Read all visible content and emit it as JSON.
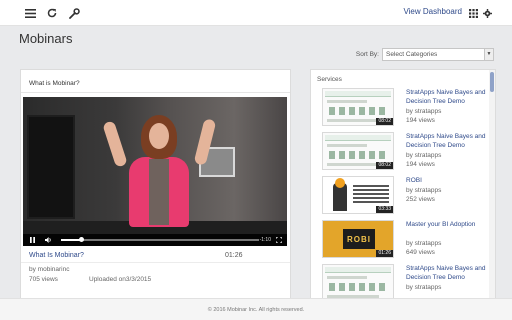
{
  "topbar": {
    "menu_icon": "hamburger-icon",
    "refresh_icon": "refresh-icon",
    "settings_icon": "wrench-icon",
    "dashboard_label": "View Dashboard",
    "grid_icon": "grid-icon",
    "gear_icon": "gear-icon"
  },
  "page": {
    "title": "Mobinars",
    "sort_label": "Sort By:",
    "sort_value": "Select Categories"
  },
  "video": {
    "panel_title": "What is Mobinar?",
    "title": "What Is Mobinar?",
    "duration": "01:26",
    "author": "by mobinarinc",
    "views": "705 views",
    "uploaded": "Uploaded on3/3/2015",
    "time_remaining": "-1:10",
    "progress": 0.1
  },
  "services": {
    "heading": "Services",
    "items": [
      {
        "title": "StratApps Naive Bayes and Decision Tree Demo",
        "author": "by stratapps",
        "views": "194 views",
        "duration": "08:02",
        "thumb": "diagram"
      },
      {
        "title": "StratApps Naive Bayes and Decision Tree Demo",
        "author": "by stratapps",
        "views": "194 views",
        "duration": "08:02",
        "thumb": "diagram"
      },
      {
        "title": "ROBI",
        "author": "by stratapps",
        "views": "252 views",
        "duration": "03:33",
        "thumb": "robi"
      },
      {
        "title": "Master your BI Adoption",
        "author": "by stratapps",
        "views": "649 views",
        "duration": "01:26",
        "thumb": "bi",
        "thumb_text": "ROBI"
      },
      {
        "title": "StratApps Naive Bayes and Decision Tree Demo",
        "author": "by stratapps",
        "views": "",
        "duration": "",
        "thumb": "diagram"
      }
    ]
  },
  "footer": {
    "text": "© 2016 Mobinar Inc. All rights reserved."
  },
  "colors": {
    "link": "#2f4a8a",
    "accent_pink": "#e83b6f",
    "scroll_thumb": "#8fa2c8"
  }
}
